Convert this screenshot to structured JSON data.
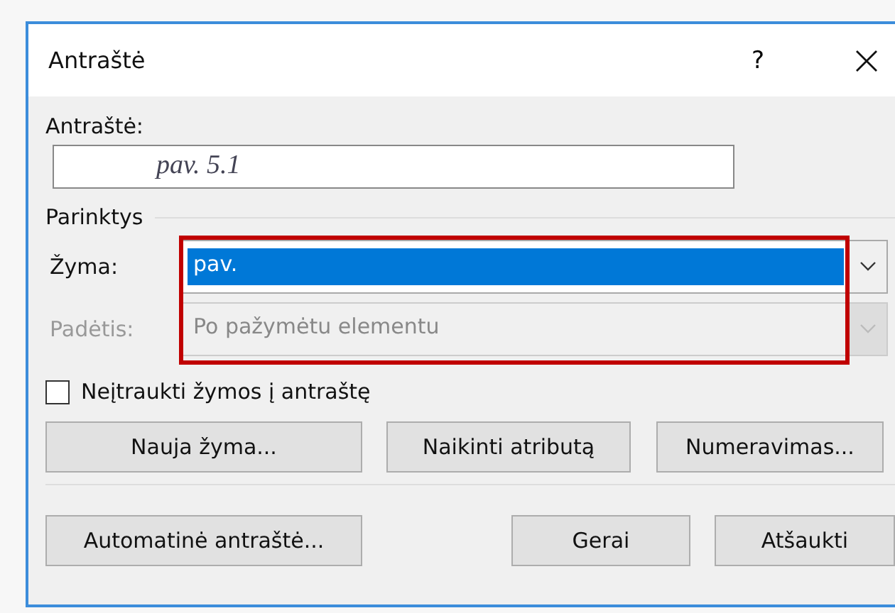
{
  "window": {
    "title": "Antraštė",
    "help": "?"
  },
  "caption": {
    "label": "Antraštė:",
    "value": "pav. 5.1"
  },
  "options": {
    "title": "Parinktys",
    "fields": [
      {
        "label": "Žyma:",
        "value": "pav.",
        "selected": true,
        "disabled": false
      },
      {
        "label": "Padėtis:",
        "value": "Po pažymėtu elementu",
        "selected": false,
        "disabled": true
      }
    ]
  },
  "exclude_label": {
    "label": "Neįtraukti žymos į antraštę",
    "checked": false
  },
  "buttons_row": [
    "Nauja žyma...",
    "Naikinti atributą",
    "Numeravimas..."
  ],
  "footer": {
    "auto": "Automatinė antraštė...",
    "ok": "Gerai",
    "cancel": "Atšaukti"
  }
}
